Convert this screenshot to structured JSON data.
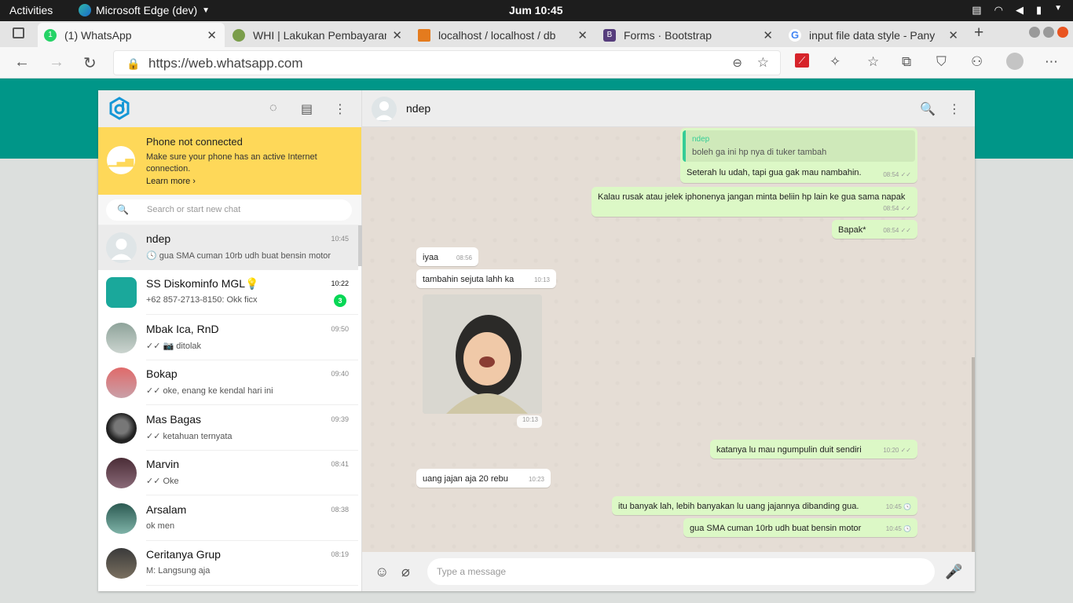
{
  "os": {
    "activities": "Activities",
    "app": "Microsoft Edge (dev)",
    "clock": "Jum 10:45"
  },
  "tabs": [
    {
      "title": "(1) WhatsApp",
      "icon": "1"
    },
    {
      "title": "WHI | Lakukan Pembayaran",
      "icon": ""
    },
    {
      "title": "localhost / localhost / db",
      "icon": ""
    },
    {
      "title": "Forms · Bootstrap",
      "icon": "B"
    },
    {
      "title": "input file data style - Pany",
      "icon": "G"
    }
  ],
  "url": "https://web.whatsapp.com",
  "colors": {
    "brand": "#009688",
    "outgoing": "#dcf8c6",
    "notice": "#fed859",
    "badge": "#06d755"
  },
  "sidebar": {
    "notice": {
      "title": "Phone not connected",
      "text": "Make sure your phone has an active Internet connection.",
      "link": "Learn more ›"
    },
    "search_placeholder": "Search or start new chat",
    "chats": [
      {
        "name": "ndep",
        "time": "10:45",
        "last": "🕓 gua SMA cuman 10rb udh buat bensin motor"
      },
      {
        "name": "SS Diskominfo MGL💡",
        "time": "10:22",
        "last": "+62 857-2713-8150: Okk ficx",
        "unread": "3"
      },
      {
        "name": "Mbak Ica, RnD",
        "time": "09:50",
        "last": "✓✓ 📷 ditolak"
      },
      {
        "name": "Bokap",
        "time": "09:40",
        "last": "✓✓ oke, enang ke kendal hari ini"
      },
      {
        "name": "Mas Bagas",
        "time": "09:39",
        "last": "✓✓ ketahuan ternyata"
      },
      {
        "name": "Marvin",
        "time": "08:41",
        "last": "✓✓ Oke"
      },
      {
        "name": "Arsalam",
        "time": "08:38",
        "last": "ok men"
      },
      {
        "name": "Ceritanya Grup",
        "time": "08:19",
        "last": "M: Langsung aja"
      }
    ]
  },
  "conversation": {
    "contact": "ndep",
    "quote": {
      "author": "ndep",
      "text": "boleh ga ini hp nya di tuker tambah"
    },
    "messages": [
      {
        "text": "Seterah lu udah, tapi gua gak mau nambahin.",
        "time": "08:54 ✓✓"
      },
      {
        "text": "Kalau rusak atau jelek iphonenya jangan minta beliin hp lain ke gua sama napak",
        "time": "08:54 ✓✓"
      },
      {
        "text": "Bapak*",
        "time": "08:54 ✓✓"
      },
      {
        "text": "iyaa",
        "time": "08:56"
      },
      {
        "text": "tambahin sejuta lahh ka",
        "time": "10:13"
      },
      {
        "text": "",
        "time": "10:13"
      },
      {
        "text": "katanya lu mau ngumpulin duit sendiri",
        "time": "10:20 ✓✓"
      },
      {
        "text": "uang jajan aja 20 rebu",
        "time": "10:23"
      },
      {
        "text": "itu banyak lah, lebih banyakan lu uang jajannya dibanding gua.",
        "time": "10:45 🕓"
      },
      {
        "text": "gua SMA cuman 10rb udh buat bensin motor",
        "time": "10:45 🕓"
      }
    ],
    "composer_placeholder": "Type a message"
  }
}
